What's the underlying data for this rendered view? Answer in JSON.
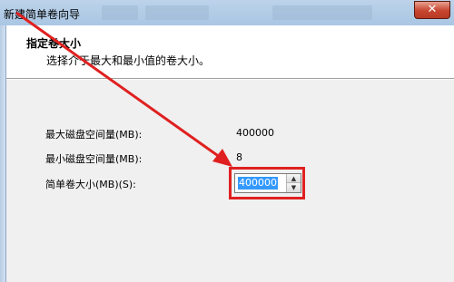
{
  "window": {
    "title": "新建简单卷向导",
    "close_glyph": "✕"
  },
  "header": {
    "title": "指定卷大小",
    "subtitle": "选择介于最大和最小值的卷大小。"
  },
  "fields": {
    "max_label": "最大磁盘空间量(MB):",
    "max_value": "400000",
    "min_label": "最小磁盘空间量(MB):",
    "min_value": "8",
    "size_label": "简单卷大小(MB)(S):",
    "size_value": "400000"
  },
  "icons": {
    "spin_up": "▲",
    "spin_down": "▼"
  },
  "colors": {
    "annotation": "#e02020",
    "selection": "#3399ff"
  }
}
